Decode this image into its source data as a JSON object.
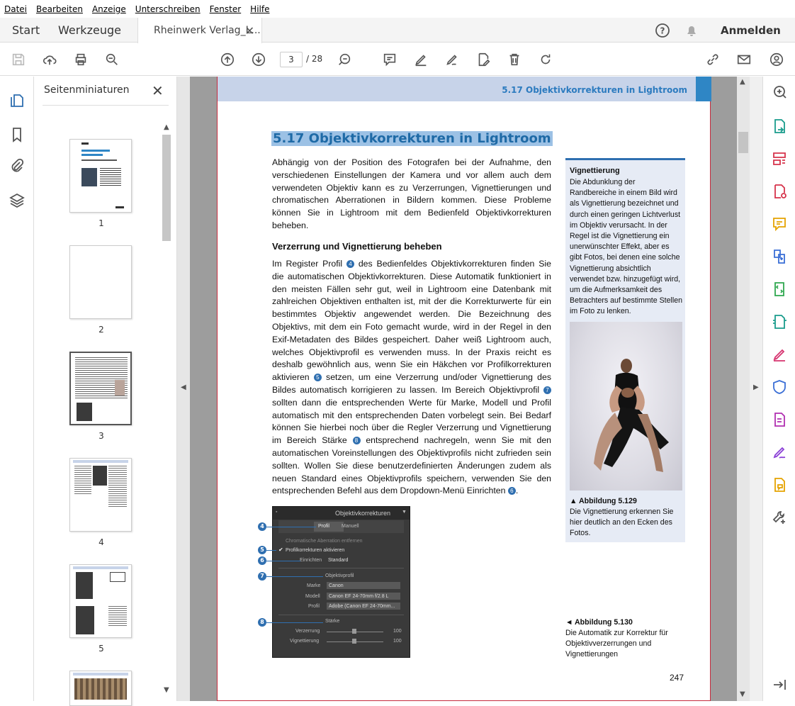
{
  "menu": [
    "Datei",
    "Bearbeiten",
    "Anzeige",
    "Unterschreiben",
    "Fenster",
    "Hilfe"
  ],
  "tabs": {
    "start": "Start",
    "tools": "Werkzeuge",
    "document": "Rheinwerk Verlag_L...",
    "signin": "Anmelden"
  },
  "toolbar": {
    "current_page": "3",
    "page_total": "/ 28"
  },
  "thumbnails": {
    "title": "Seitenminiaturen",
    "pages": [
      "1",
      "2",
      "3",
      "4",
      "5"
    ]
  },
  "pdf": {
    "running_head": "5.17   Objektivkorrekturen in Lightroom",
    "heading": "5.17  Objektivkorrekturen in Lightroom",
    "intro": "Abhängig von der Position des Fotografen bei der Aufnahme, den verschiedenen Einstellungen der Kamera und vor allem auch dem verwendeten Objektiv kann es zu Verzerrungen, Vignettierungen und chromatischen Aberrationen in Bildern kommen. Diese Probleme können Sie in Lightroom mit dem Bedienfeld Objektivkorrekturen beheben.",
    "subheading": "Verzerrung und Vignettierung beheben",
    "para_a": "Im Register Profil",
    "para_b": "des Bedienfeldes Objektivkorrekturen finden Sie die automatischen Objektivkorrekturen. Diese Automatik funktioniert in den meisten Fällen sehr gut, weil in Lightroom eine Datenbank mit zahlreichen Objektiven enthalten ist, mit der die Korrekturwerte für ein bestimmtes Objektiv angewendet werden. Die Bezeichnung des Objektivs, mit dem ein Foto gemacht wurde, wird in der Regel in den Exif-Metadaten des Bildes gespeichert. Daher weiß Lightroom auch, welches Objektivprofil es verwenden muss. In der Praxis reicht es deshalb gewöhnlich aus, wenn Sie ein Häkchen vor Profilkorrekturen aktivieren",
    "para_c": "setzen, um eine Verzerrung und/oder Vignettierung des Bildes automatisch korrigieren zu lassen. Im Bereich Objektivprofil",
    "para_d": "sollten dann die entsprechenden Werte für Marke, Modell und Profil automatisch mit den entsprechenden Daten vorbelegt sein. Bei Bedarf können Sie hierbei noch über die Regler Verzerrung und Vignettierung im Bereich Stärke",
    "para_e": "entsprechend nachregeln, wenn Sie mit den automatischen Voreinstellungen des Objektivprofils nicht zufrieden sein sollten. Wollen Sie diese benutzerdefinierten Änderungen zudem als neuen Standard eines Objektivprofils speichern, verwenden Sie den entsprechenden Befehl aus dem Dropdown-Menü Einrichten",
    "badges": [
      "4",
      "5",
      "7",
      "8",
      "6"
    ],
    "sidebar_title": "Vignettierung",
    "sidebar_text": "Die Abdunklung der Randbereiche in einem Bild wird als Vignettierung bezeichnet und durch einen geringen Lichtverlust im Objektiv verursacht. In der Regel ist die Vignettierung ein unerwünschter Effekt, aber es gibt Fotos, bei denen eine solche Vignettierung absichtlich verwendet bzw. hinzugefügt wird, um die Aufmerksamkeit des Betrachters auf bestimmte Stellen im Foto zu lenken.",
    "fig129_label": "▲ Abbildung 5.129",
    "fig129_text": "Die Vignettierung erkennen Sie hier deutlich an den Ecken des Fotos.",
    "fig130_label": "◄ Abbildung 5.130",
    "fig130_text": "Die Automatik zur Korrektur für Objektivverzerrungen und Vignettierungen",
    "page_number": "247"
  },
  "lr_panel": {
    "title": "Objektivkorrekturen",
    "tab_profile": "Profil",
    "tab_manual": "Manuell",
    "chk_ca": "Chromatische Aberration entfernen",
    "chk_profile": "Profilkorrekturen aktivieren",
    "setup_label": "Einrichten",
    "setup_value": "Standard",
    "section_profile": "Objektivprofil",
    "make_label": "Marke",
    "make_value": "Canon",
    "model_label": "Modell",
    "model_value": "Canon EF 24-70mm f/2.8 L",
    "prof_label": "Profil",
    "prof_value": "Adobe (Canon EF 24-70mm...",
    "section_amount": "Stärke",
    "dist_label": "Verzerrung",
    "dist_value": "100",
    "vig_label": "Vignettierung",
    "vig_value": "100",
    "callouts": [
      "4",
      "5",
      "6",
      "7",
      "8"
    ]
  },
  "colors": {
    "accent": "#2f6fb0",
    "runhead": "#c7d3e9",
    "highlight": "#9cc1e5",
    "page_border": "#c52b3d"
  }
}
